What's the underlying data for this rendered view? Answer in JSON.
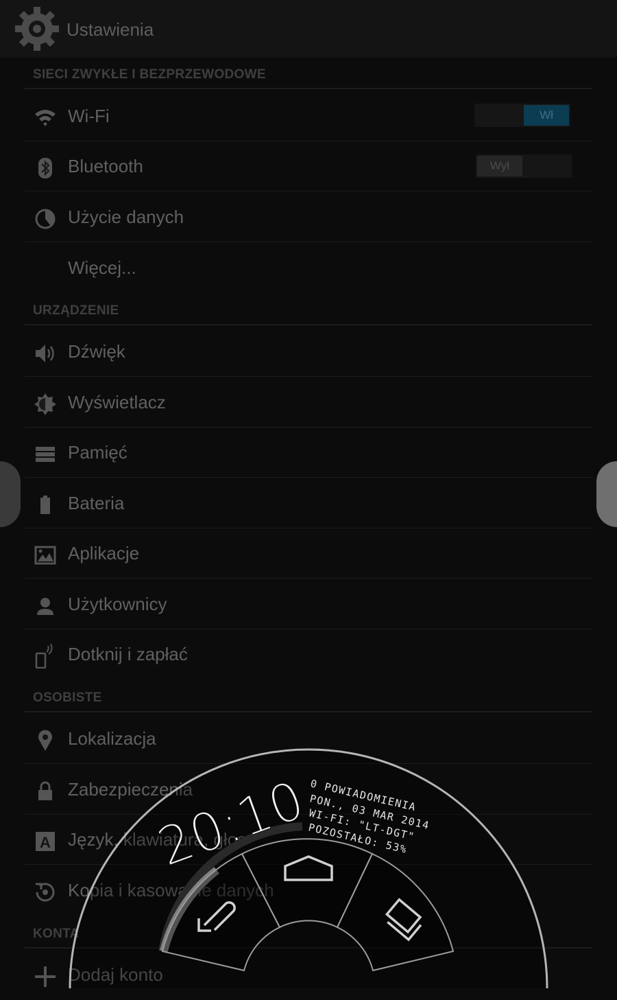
{
  "action_bar": {
    "title": "Ustawienia",
    "icon": "gear-icon"
  },
  "sections": {
    "wireless": "SIECI ZWYKŁE I BEZPRZEWODOWE",
    "device": "URZĄDZENIE",
    "personal": "OSOBISTE",
    "accounts": "KONTA"
  },
  "items": {
    "wifi": {
      "label": "Wi-Fi",
      "icon": "wifi-icon",
      "switch": "Wł"
    },
    "bluetooth": {
      "label": "Bluetooth",
      "icon": "bluetooth-icon",
      "switch": "Wył"
    },
    "data_usage": {
      "label": "Użycie danych",
      "icon": "data-usage-icon"
    },
    "more": {
      "label": "Więcej..."
    },
    "sound": {
      "label": "Dźwięk",
      "icon": "speaker-icon"
    },
    "display": {
      "label": "Wyświetlacz",
      "icon": "brightness-icon"
    },
    "storage": {
      "label": "Pamięć",
      "icon": "storage-icon"
    },
    "battery": {
      "label": "Bateria",
      "icon": "battery-icon"
    },
    "apps": {
      "label": "Aplikacje",
      "icon": "apps-icon"
    },
    "users": {
      "label": "Użytkownicy",
      "icon": "user-icon"
    },
    "tap_pay": {
      "label": "Dotknij i zapłać",
      "icon": "nfc-phone-icon"
    },
    "location": {
      "label": "Lokalizacja",
      "icon": "location-pin-icon"
    },
    "security": {
      "label": "Zabezpieczenia",
      "icon": "lock-icon"
    },
    "language": {
      "label": "Język, klawiatura, głos",
      "icon": "keyboard-a-icon"
    },
    "backup": {
      "label": "Kopia i kasowanie danych",
      "icon": "backup-icon"
    },
    "add_account": {
      "label": "Dodaj konto",
      "icon": "plus-icon"
    }
  },
  "pie": {
    "clock": "20:10",
    "notifications": "0 POWIADOMIENIA",
    "date": "PON., 03 MAR 2014",
    "wifi": "WI-FI: \"LT-DGT\"",
    "battery": "POZOSTAŁO: 53%",
    "battery_level": 0.53,
    "buttons": [
      "back-icon",
      "home-icon",
      "recent-apps-icon"
    ]
  },
  "colors": {
    "switch_on": "#0c3c52",
    "switch_on_text": "#3b6f87",
    "pie_outline": "#b5b5b5",
    "battery_arc": "#808080"
  }
}
